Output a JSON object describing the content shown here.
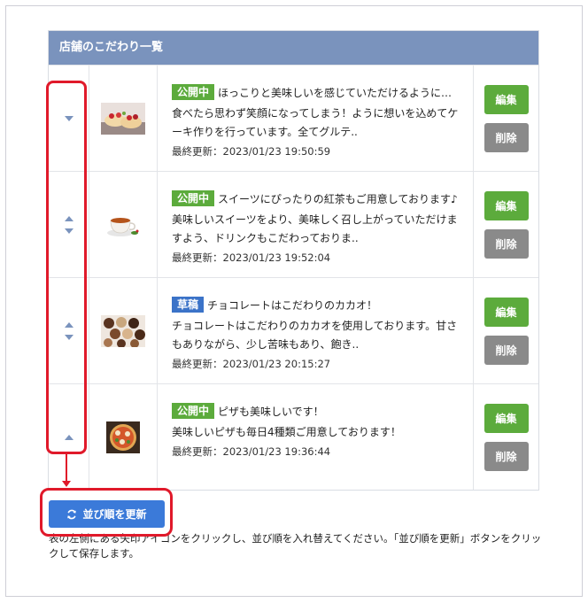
{
  "panel": {
    "title": "店舗のこだわり一覧"
  },
  "items": [
    {
      "status": "公開中",
      "status_type": "pub",
      "title": "ほっこりと美味しいを感じていただけるように…",
      "desc": "食べたら思わず笑顔になってしまう！ように想いを込めてケーキ作りを行っています。全てグルテ..",
      "updated": "最終更新：2023/01/23 19:50:59",
      "show_up": false,
      "show_down": true
    },
    {
      "status": "公開中",
      "status_type": "pub",
      "title": "スイーツにぴったりの紅茶もご用意しております♪",
      "desc": "美味しいスイーツをより、美味しく召し上がっていただけますよう、ドリンクもこだわっておりま..",
      "updated": "最終更新：2023/01/23 19:52:04",
      "show_up": true,
      "show_down": true
    },
    {
      "status": "草稿",
      "status_type": "draft",
      "title": "チョコレートはこだわりのカカオ！",
      "desc": "チョコレートはこだわりのカカオを使用しております。甘さもありながら、少し苦味もあり、飽き..",
      "updated": "最終更新：2023/01/23 20:15:27",
      "show_up": true,
      "show_down": true
    },
    {
      "status": "公開中",
      "status_type": "pub",
      "title": "ピザも美味しいです！",
      "desc": "美味しいピザも毎日4種類ご用意しております！",
      "updated": "最終更新：2023/01/23 19:36:44",
      "show_up": true,
      "show_down": false
    }
  ],
  "actions": {
    "edit_label": "編集",
    "delete_label": "削除"
  },
  "update_button": {
    "label": "並び順を更新",
    "icon": "refresh-icon"
  },
  "help_text": "表の左側にある矢印アイコンをクリックし、並び順を入れ替えてください。「並び順を更新」ボタンをクリックして保存します。",
  "colors": {
    "header": "#7a93bd",
    "published": "#5cab3c",
    "draft": "#3b73c8",
    "delete": "#8a8a8a",
    "primary": "#3b7ad9",
    "annotation": "#e0192a"
  }
}
